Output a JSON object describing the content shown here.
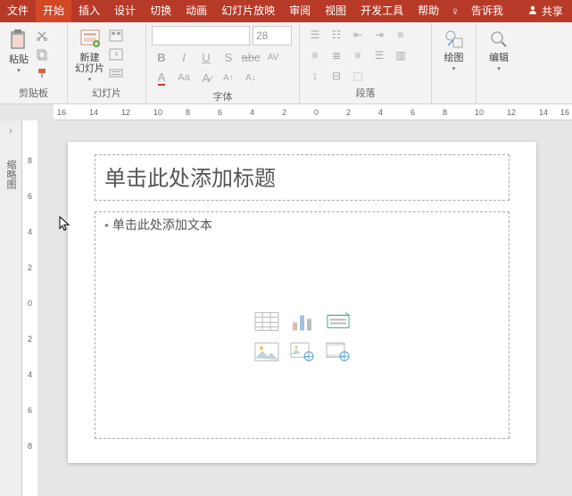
{
  "menubar": {
    "file": "文件",
    "home": "开始",
    "insert": "插入",
    "design": "设计",
    "transitions": "切换",
    "animations": "动画",
    "slideshow": "幻灯片放映",
    "review": "审阅",
    "view": "视图",
    "developer": "开发工具",
    "help": "帮助",
    "tellme": "告诉我",
    "share": "共享"
  },
  "ribbon": {
    "clipboard": {
      "paste": "粘贴",
      "label": "剪贴板"
    },
    "slides": {
      "new_slide": "新建\n幻灯片",
      "label": "幻灯片"
    },
    "font": {
      "size": "28",
      "label": "字体"
    },
    "paragraph": {
      "label": "段落"
    },
    "drawing": {
      "draw": "绘图",
      "label": ""
    },
    "editing": {
      "edit": "编辑",
      "label": ""
    }
  },
  "outline": {
    "label": "缩略图"
  },
  "slide": {
    "title_placeholder": "单击此处添加标题",
    "body_placeholder": "单击此处添加文本"
  },
  "ruler": {
    "h": [
      "16",
      "14",
      "12",
      "10",
      "8",
      "6",
      "4",
      "2",
      "0",
      "2",
      "4",
      "6",
      "8",
      "10",
      "12",
      "14",
      "16"
    ],
    "v": [
      "8",
      "6",
      "4",
      "2",
      "0",
      "2",
      "4",
      "6",
      "8"
    ]
  }
}
